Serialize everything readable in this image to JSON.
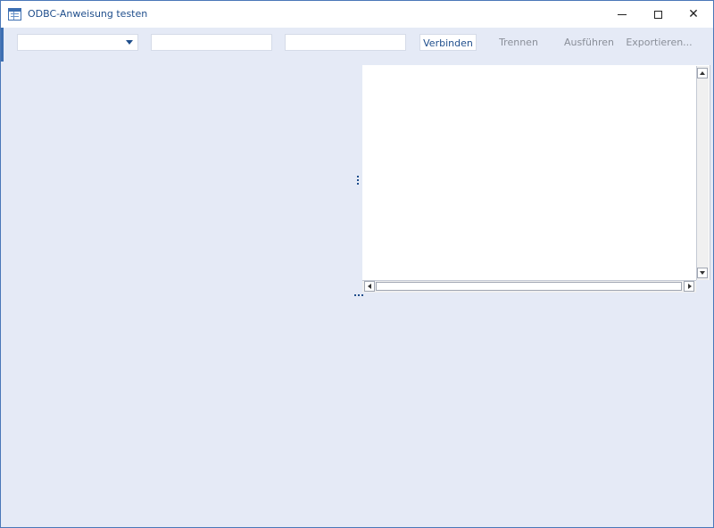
{
  "window": {
    "title": "ODBC-Anweisung testen",
    "icon": "table-window-icon",
    "controls": [
      "minimize-icon",
      "maximize-icon",
      "close-icon"
    ]
  },
  "toolbar": {
    "dsn_select_value": "",
    "user_value": "",
    "password_value": "",
    "connect_label": "Verbinden",
    "disconnect_label": "Trennen",
    "execute_label": "Ausführen",
    "export_label": "Exportieren..."
  },
  "colors": {
    "window_background": "#e5eaf6",
    "accent": "#3d6fb2",
    "title_text": "#1f4e8c",
    "disabled_text": "#8a8f99"
  },
  "results_grid": {
    "rows": []
  }
}
